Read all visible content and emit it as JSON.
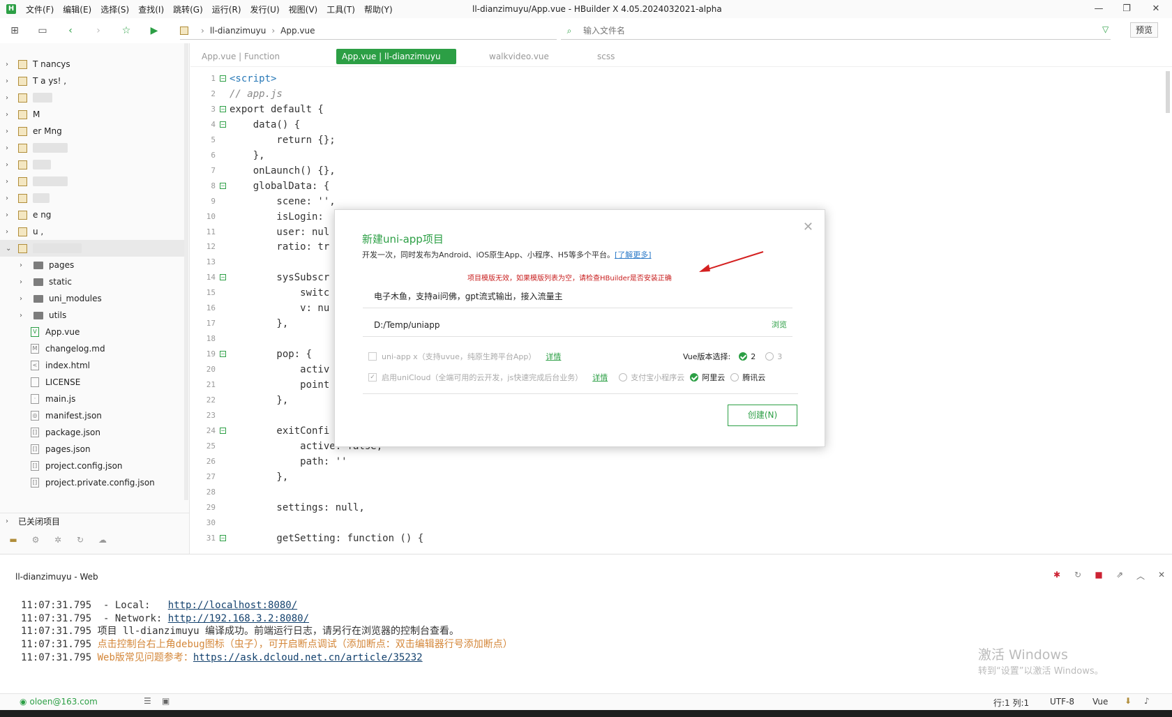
{
  "menu": {
    "items": [
      "文件(F)",
      "编辑(E)",
      "选择(S)",
      "查找(I)",
      "跳转(G)",
      "运行(R)",
      "发行(U)",
      "视图(V)",
      "工具(T)",
      "帮助(Y)"
    ],
    "window_title": "ll-dianzimuyu/App.vue - HBuilder X 4.05.2024032021-alpha"
  },
  "toolbar": {
    "breadcrumb": [
      "ll-dianzimuyu",
      "App.vue"
    ],
    "file_search_placeholder": "输入文件名",
    "preview_label": "预览"
  },
  "sidebar": {
    "projects": [
      "T nancys",
      "T a ys! ,",
      "",
      "M",
      "er Mng",
      "",
      "",
      "",
      "",
      "e ng",
      "u ,"
    ],
    "expanded_children": [
      {
        "name": "pages",
        "type": "folder"
      },
      {
        "name": "static",
        "type": "folder"
      },
      {
        "name": "uni_modules",
        "type": "folder"
      },
      {
        "name": "utils",
        "type": "folder"
      },
      {
        "name": "App.vue",
        "type": "vue"
      },
      {
        "name": "changelog.md",
        "type": "md"
      },
      {
        "name": "index.html",
        "type": "html"
      },
      {
        "name": "LICENSE",
        "type": "file"
      },
      {
        "name": "main.js",
        "type": "js"
      },
      {
        "name": "manifest.json",
        "type": "manifest"
      },
      {
        "name": "package.json",
        "type": "json"
      },
      {
        "name": "pages.json",
        "type": "json"
      },
      {
        "name": "project.config.json",
        "type": "json"
      },
      {
        "name": "project.private.config.json",
        "type": "json"
      }
    ],
    "closed_projects_label": "已关闭项目"
  },
  "editor": {
    "tabs": [
      {
        "label": "App.vue | Function",
        "active": false
      },
      {
        "label": "App.vue | ll-dianzimuyu",
        "active": true
      },
      {
        "label": "walkvideo.vue",
        "active": false
      },
      {
        "label": "scss",
        "active": false
      }
    ],
    "line_numbers": [
      "1",
      "2",
      "3",
      "4",
      "5",
      "6",
      "7",
      "8",
      "9",
      "10",
      "11",
      "12",
      "13",
      "14",
      "15",
      "16",
      "17",
      "18",
      "19",
      "20",
      "21",
      "22",
      "23",
      "24",
      "25",
      "26",
      "27",
      "28",
      "29",
      "30",
      "31"
    ],
    "code": [
      "<script>",
      "// app.js",
      "export default {",
      "    data() {",
      "        return {};",
      "    },",
      "    onLaunch() {},",
      "    globalData: {",
      "        scene: '',",
      "        isLogin:",
      "        user: nul",
      "        ratio: tr",
      "",
      "        sysSubscr",
      "            switc",
      "            v: nu",
      "        },",
      "",
      "        pop: {",
      "            activ",
      "            point",
      "        },",
      "",
      "        exitConfi",
      "            active: false,",
      "            path: ''",
      "        },",
      "",
      "        settings: null,",
      "",
      "        getSetting: function () {"
    ]
  },
  "console": {
    "title": "ll-dianzimuyu - Web",
    "logs": [
      {
        "time": "11:07:31.795",
        "prefix": "  - Local:   ",
        "text": "http://localhost:8080/",
        "kind": "link"
      },
      {
        "time": "11:07:31.795",
        "prefix": "  - Network: ",
        "text": "http://192.168.3.2:8080/",
        "kind": "link"
      },
      {
        "time": "11:07:31.795",
        "prefix": " ",
        "text": "项目 ll-dianzimuyu 编译成功。前端运行日志，请另行在浏览器的控制台查看。",
        "kind": "plain"
      },
      {
        "time": "11:07:31.795",
        "prefix": " ",
        "text": "点击控制台右上角debug图标（虫子），可开启断点调试（添加断点：双击编辑器行号添加断点）",
        "kind": "warn"
      },
      {
        "time": "11:07:31.795",
        "prefix": " Web版常见问题参考：",
        "text": "https://ask.dcloud.net.cn/article/35232",
        "kind": "link-warn"
      }
    ],
    "activate_title": "激活 Windows",
    "activate_sub": "转到“设置”以激活 Windows。"
  },
  "statusbar": {
    "user": "oloen@163.com",
    "position": "行:1  列:1",
    "encoding": "UTF-8",
    "language": "Vue"
  },
  "modal": {
    "title": "新建uni-app项目",
    "description": "开发一次，同时发布为Android、iOS原生App、小程序、H5等多个平台。",
    "learn_more": "[了解更多]",
    "warning": "项目模版无效，如果模版列表为空，请检查HBuilder是否安装正确",
    "project_name": "电子木鱼，支持ai问佛，gpt流式输出，接入流量主",
    "location": "D:/Temp/uniapp",
    "browse_label": "浏览",
    "uniappx_label": "uni-app x（支持uvue，纯原生跨平台App）",
    "detail_label": "详情",
    "vue_version_label": "Vue版本选择:",
    "vue_options": [
      "2",
      "3"
    ],
    "unicloud_label": "启用uniCloud（全端可用的云开发，js快速完成后台业务）",
    "cloud_options": [
      "支付宝小程序云",
      "阿里云",
      "腾讯云"
    ],
    "create_label": "创建(N)"
  },
  "colors": {
    "accent": "#2c9f45",
    "warning": "#c81e1e",
    "link": "#14426e"
  }
}
